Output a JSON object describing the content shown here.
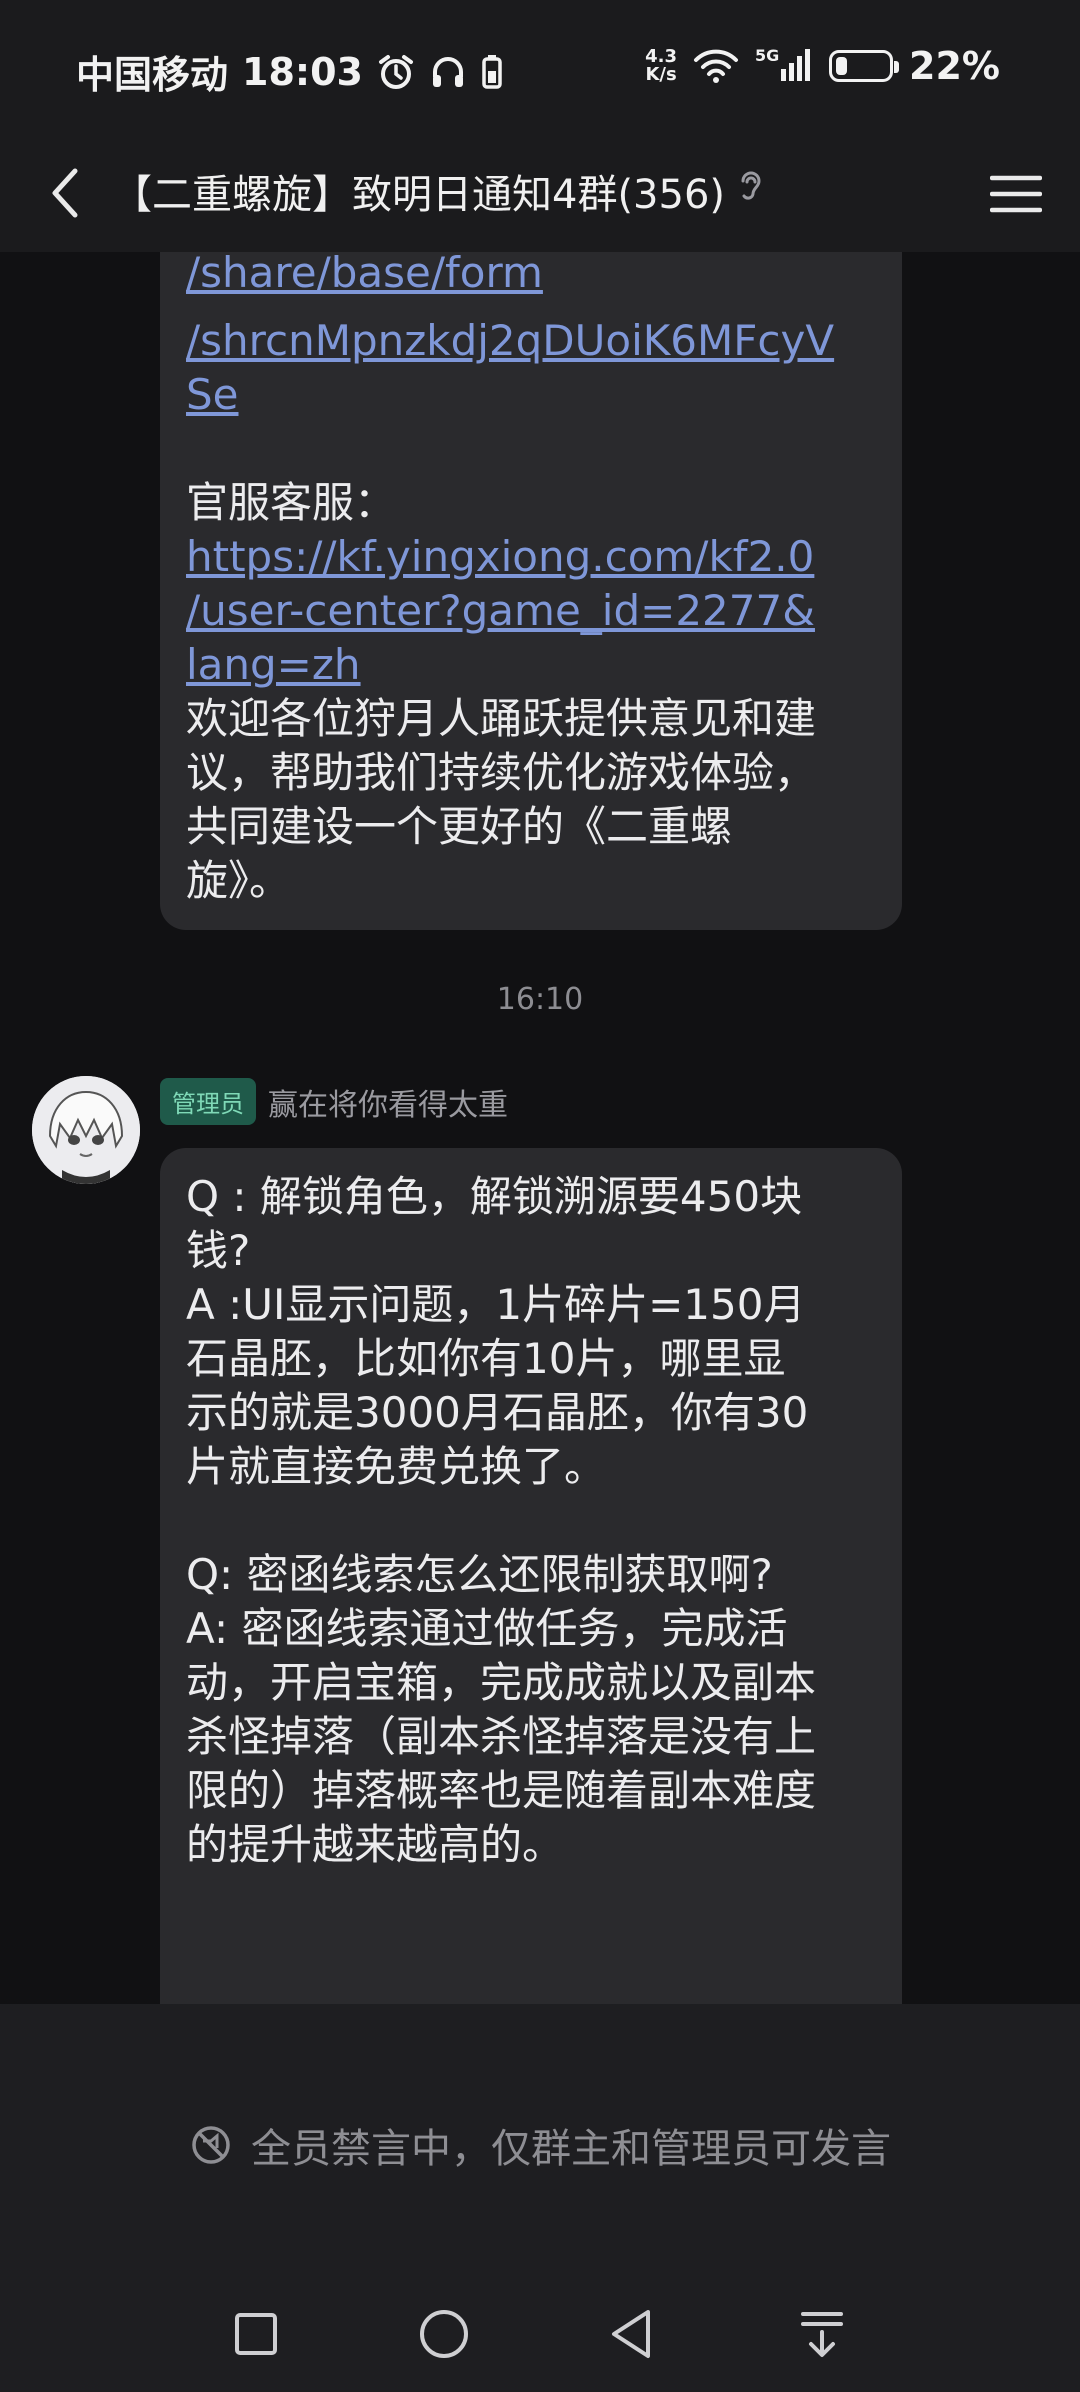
{
  "status_bar": {
    "carrier": "中国移动",
    "time": "18:03",
    "net_speed_value": "4.3",
    "net_speed_unit": "K/s",
    "battery_percent": "22%",
    "battery_level": 0.22,
    "icons": [
      "alarm-icon",
      "headphones-icon",
      "battery-saver-icon",
      "wifi-icon",
      "signal-icon",
      "battery-icon"
    ]
  },
  "nav": {
    "title": "【二重螺旋】致明日通知4群(356)",
    "icons": [
      "back-icon",
      "ear-icon",
      "menu-icon"
    ]
  },
  "messages": {
    "first": {
      "link_partial": "/share/base/form",
      "link_line1": "/shrcnMpnzkdj2qDUoiK6MFcyV",
      "link_line2": "Se",
      "kf_label": "官服客服：",
      "kf_link1": "https://kf.yingxiong.com/kf2.0",
      "kf_link2": "/user-center?game_id=2277&",
      "kf_link3": "lang=zh",
      "text1": "欢迎各位狩月人踊跃提供意见和建",
      "text2": "议，帮助我们持续优化游戏体验，",
      "text3": "共同建设一个更好的《二重螺",
      "text4": "旋》。"
    },
    "timestamp": "16:10",
    "second": {
      "role": "管理员",
      "sender": "赢在将你看得太重",
      "lines": [
        "Q : 解锁角色，解锁溯源要450块",
        "钱?",
        "A :UI显示问题，1片碎片=150月",
        "石晶胚，比如你有10片，哪里显",
        "示的就是3000月石晶胚，你有30",
        "片就直接免费兑换了。",
        "",
        "Q: 密函线索怎么还限制获取啊?",
        "A: 密函线索通过做任务，完成活",
        "动，开启宝箱，完成成就以及副本",
        "杀怪掉落（副本杀怪掉落是没有上",
        "限的）掉落概率也是随着副本难度",
        "的提升越来越高的。"
      ]
    }
  },
  "bottom": {
    "muted_notice": "全员禁言中，仅群主和管理员可发言"
  },
  "system_nav": [
    "recents-square-icon",
    "home-circle-icon",
    "back-triangle-icon",
    "notification-down-icon"
  ]
}
